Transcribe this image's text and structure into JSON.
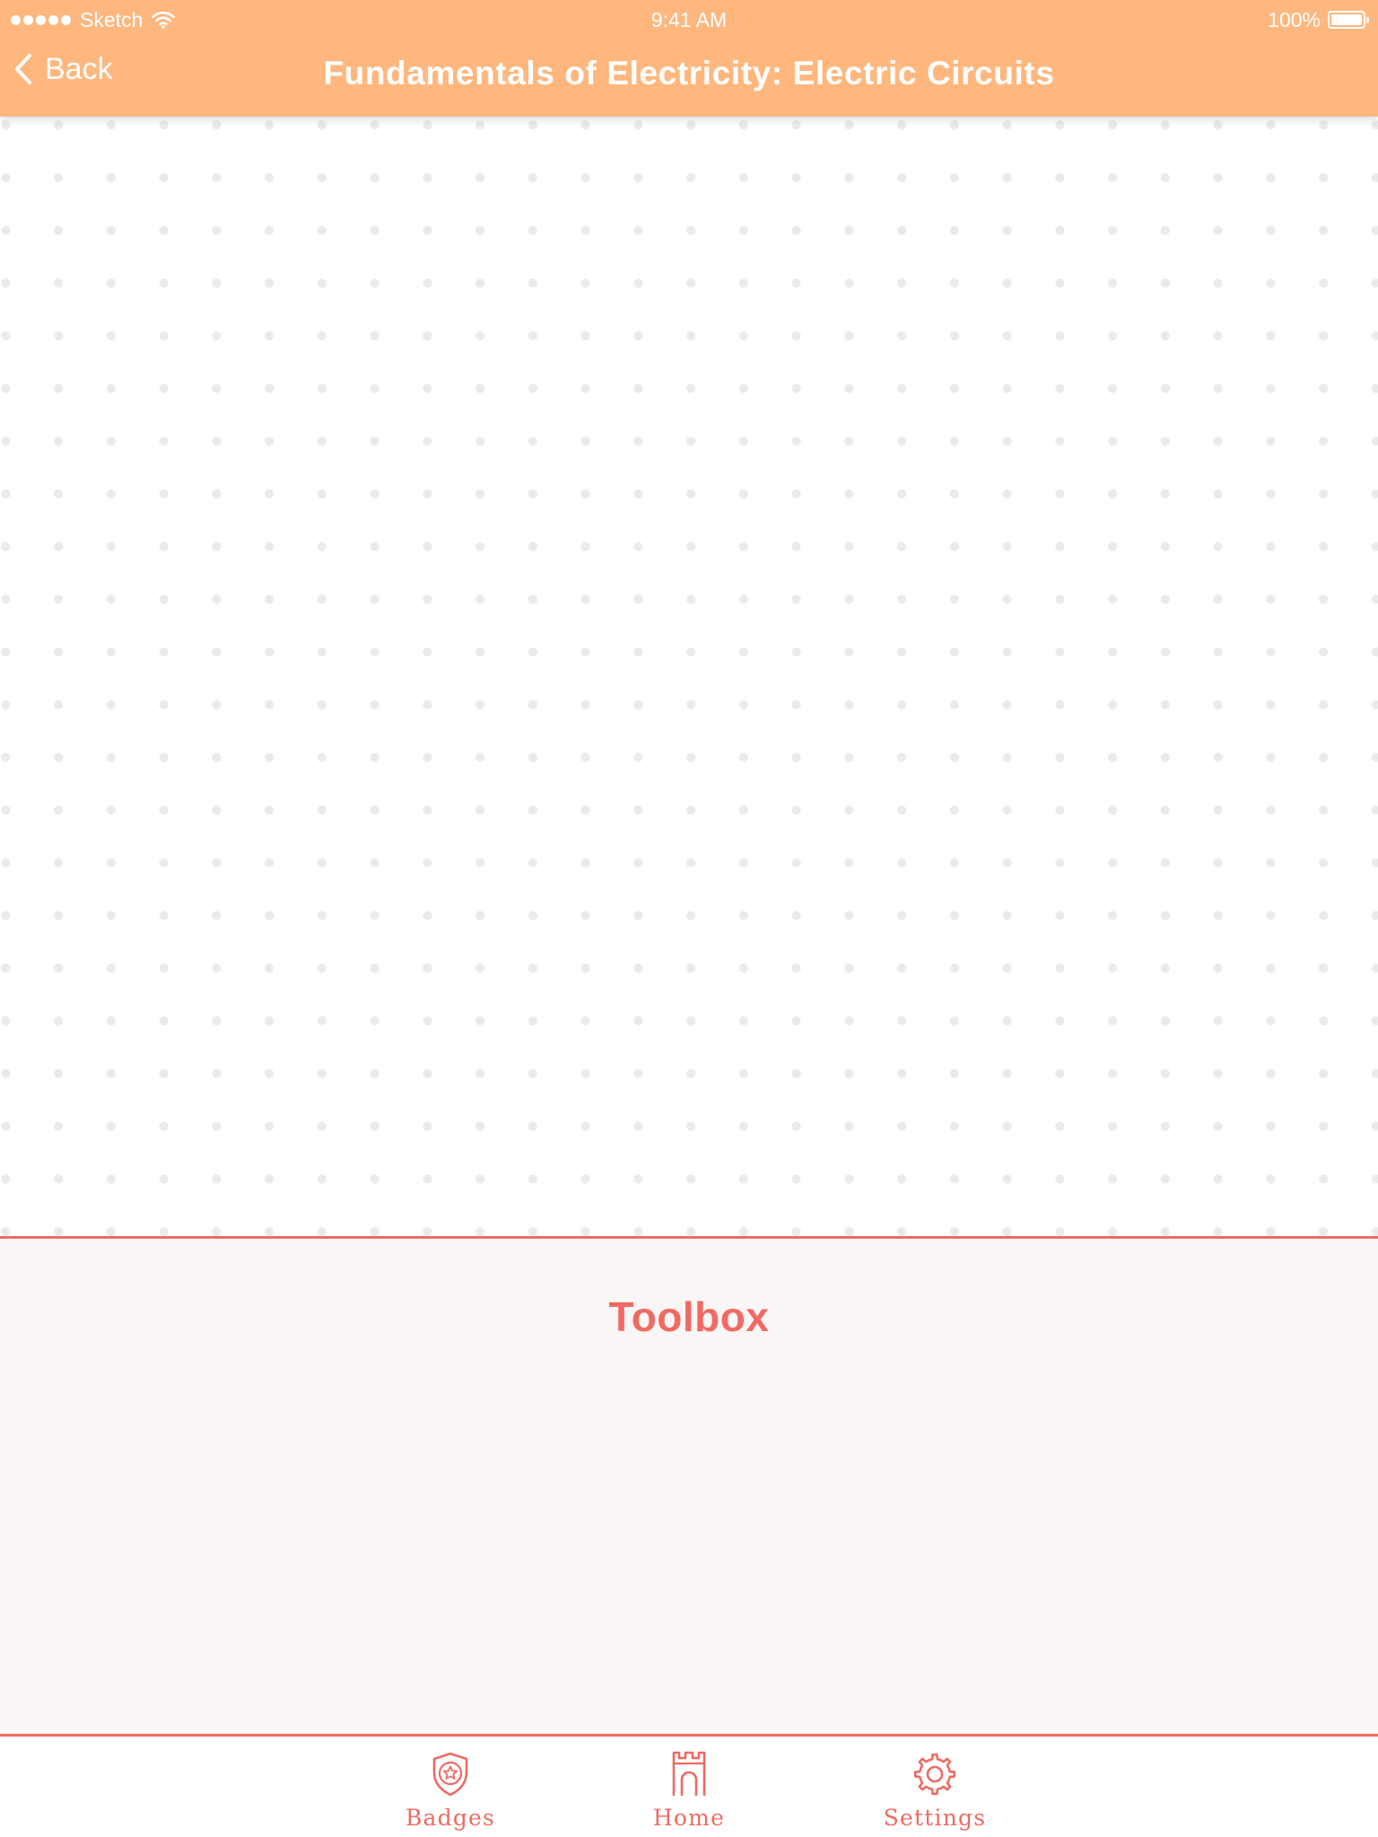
{
  "status_bar": {
    "carrier": "Sketch",
    "time": "9:41 AM",
    "battery": "100%",
    "battery_level": 1.0
  },
  "nav": {
    "back_label": "Back",
    "title": "Fundamentals of Electricity: Electric Circuits"
  },
  "toolbox": {
    "title": "Toolbox"
  },
  "tabs": [
    {
      "label": "Badges",
      "icon": "shield-star-icon"
    },
    {
      "label": "Home",
      "icon": "castle-icon"
    },
    {
      "label": "Settings",
      "icon": "gear-icon"
    }
  ],
  "colors": {
    "header": "#FFB77E",
    "accent": "#F06A63",
    "toolbox_bg": "#F9F6F5",
    "grid_dot": "#EBEAEA"
  }
}
